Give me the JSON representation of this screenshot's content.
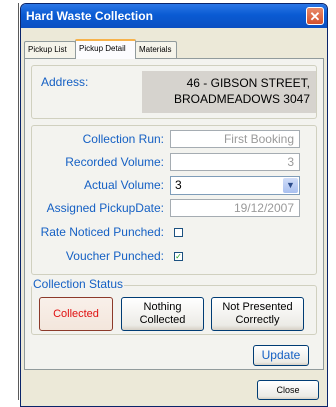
{
  "window": {
    "title": "Hard Waste Collection",
    "close_glyph": "✕"
  },
  "tabs": [
    {
      "label": "Pickup List"
    },
    {
      "label": "Pickup Detail"
    },
    {
      "label": "Materials"
    }
  ],
  "address": {
    "label": "Address:",
    "line1": "46 - GIBSON STREET,",
    "line2": "BROADMEADOWS 3047"
  },
  "details": {
    "collection_run": {
      "label": "Collection Run:",
      "value": "First Booking"
    },
    "recorded_volume": {
      "label": "Recorded Volume:",
      "value": "3"
    },
    "actual_volume": {
      "label": "Actual Volume:",
      "value": "3"
    },
    "assigned_pickup_date": {
      "label": "Assigned PickupDate:",
      "value": "19/12/2007"
    },
    "rate_noticed_punched": {
      "label": "Rate Noticed Punched:",
      "checked": false
    },
    "voucher_punched": {
      "label": "Voucher Punched:",
      "checked": true,
      "check_glyph": "✓"
    }
  },
  "collection_status": {
    "legend": "Collection Status",
    "collected": "Collected",
    "nothing_collected_line1": "Nothing",
    "nothing_collected_line2": "Collected",
    "not_presented_line1": "Not Presented",
    "not_presented_line2": "Correctly"
  },
  "actions": {
    "update": "Update",
    "close": "Close"
  }
}
